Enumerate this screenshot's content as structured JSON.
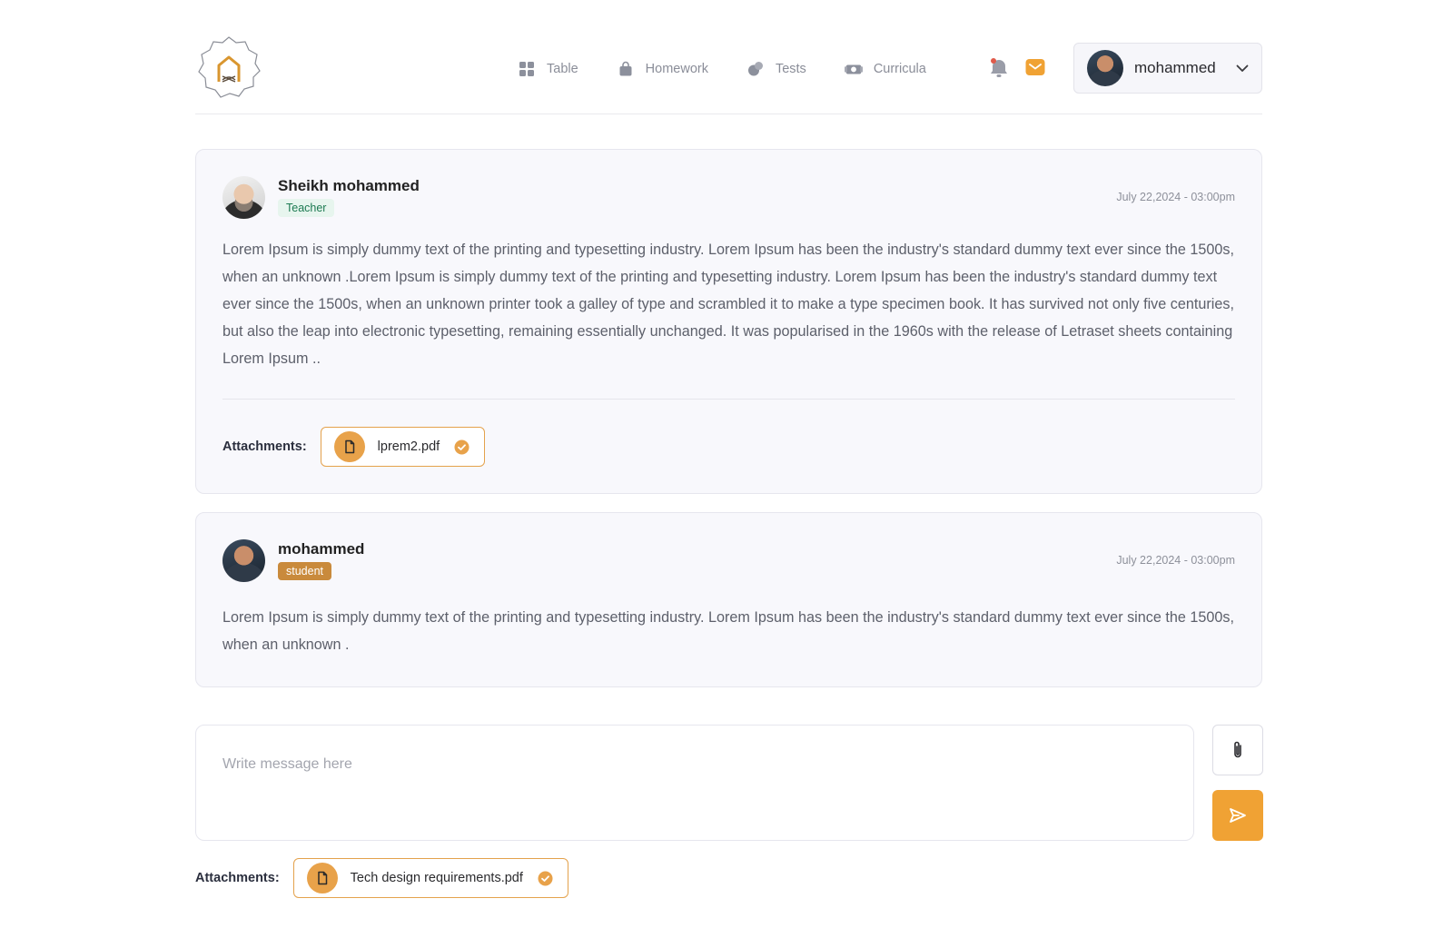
{
  "nav": {
    "items": [
      {
        "label": "Table",
        "icon": "grid-icon"
      },
      {
        "label": "Homework",
        "icon": "bag-icon"
      },
      {
        "label": "Tests",
        "icon": "tests-icon"
      },
      {
        "label": "Curricula",
        "icon": "curricula-icon"
      }
    ]
  },
  "header": {
    "notifications_icon": "bell-icon",
    "messages_icon": "mail-icon",
    "user_name": "mohammed"
  },
  "messages": [
    {
      "author": "Sheikh mohammed",
      "role": "Teacher",
      "time": "July 22,2024 - 03:00pm",
      "body": "Lorem Ipsum is simply dummy text of the printing and typesetting industry. Lorem Ipsum has been the industry's standard dummy text ever since the 1500s, when an unknown .Lorem Ipsum is simply dummy text of the printing and typesetting industry. Lorem Ipsum has been the industry's standard dummy text ever since the 1500s, when an unknown printer took a galley of type and scrambled it to make a type specimen book. It has survived not only five centuries, but also the leap into electronic typesetting, remaining essentially unchanged. It was popularised in the 1960s with the release of Letraset sheets containing Lorem Ipsum ..",
      "attachments_label": "Attachments:",
      "attachment": "lprem2.pdf"
    },
    {
      "author": "mohammed",
      "role": "student",
      "time": "July 22,2024 - 03:00pm",
      "body": "Lorem Ipsum is simply dummy text of the printing and typesetting industry. Lorem Ipsum has been the industry's standard dummy text ever since the 1500s, when an unknown ."
    }
  ],
  "composer": {
    "placeholder": "Write message here",
    "value": "",
    "attachments_label": "Attachments:",
    "attachment": "Tech design requirements.pdf"
  },
  "colors": {
    "accent": "#f0a234",
    "accent_border": "#e4a24c",
    "teacher_badge_bg": "#e7f5ee",
    "teacher_badge_text": "#1d7a52",
    "student_badge_bg": "#c98a3c",
    "card_bg": "#f8f8fc"
  }
}
